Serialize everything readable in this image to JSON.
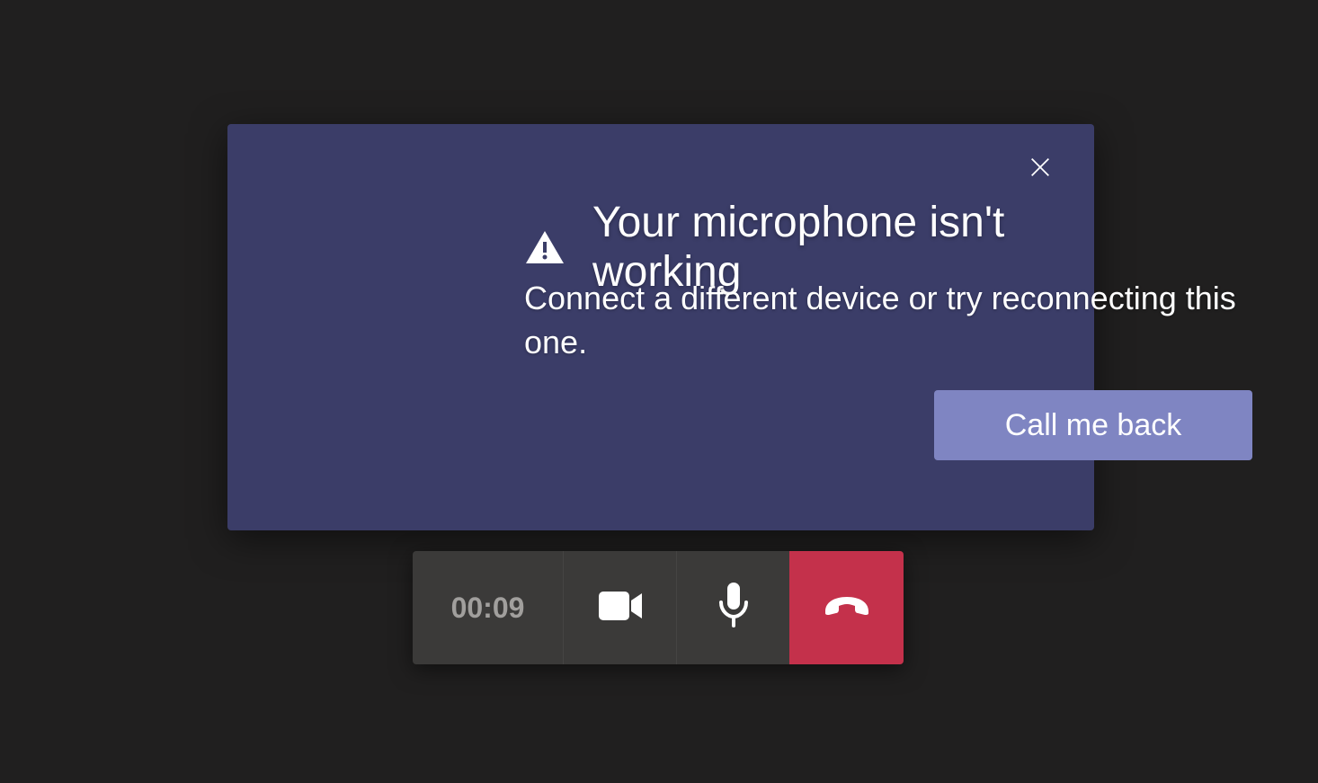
{
  "modal": {
    "title": "Your microphone isn't working",
    "body": "Connect a different device or try reconnecting this one.",
    "callback_button": "Call me back"
  },
  "callbar": {
    "timer": "00:09"
  },
  "colors": {
    "modal_bg": "#3b3d68",
    "button_bg": "#7f85c2",
    "hangup_bg": "#c4314b",
    "bar_bg": "#3b3a39",
    "page_bg": "#201f1f"
  }
}
